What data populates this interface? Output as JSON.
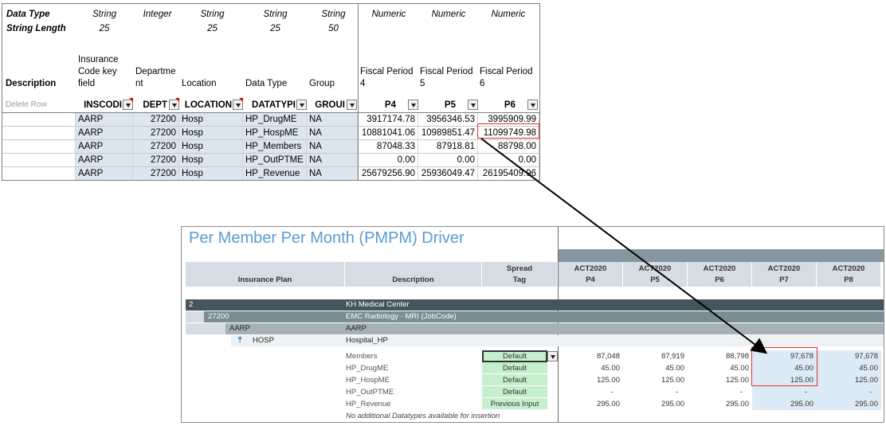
{
  "sheet": {
    "meta_labels": {
      "data_type": "Data Type",
      "string_length": "String Length"
    },
    "meta_types": [
      "String",
      "Integer",
      "String",
      "String",
      "String",
      "Numeric",
      "Numeric",
      "Numeric"
    ],
    "meta_lengths": [
      "25",
      "",
      "25",
      "25",
      "50"
    ],
    "headers": {
      "description": "Description",
      "insurance_code_1": "Insurance",
      "insurance_code_2": "Code key",
      "insurance_code_3": "field",
      "department_1": "Departme",
      "department_2": "nt",
      "location": "Location",
      "data_type": "Data Type",
      "group": "Group",
      "fp4_1": "Fiscal Period",
      "fp4_2": "4",
      "fp5_1": "Fiscal Period",
      "fp5_2": "5",
      "fp6_1": "Fiscal Period",
      "fp6_2": "6"
    },
    "delete_row": "Delete Row",
    "field_headers": [
      "INSCODI",
      "DEPT",
      "LOCATION",
      "DATATYPI",
      "GROUI",
      "P4",
      "P5",
      "P6"
    ],
    "rows": [
      [
        "AARP",
        "27200",
        "Hosp",
        "HP_DrugME",
        "NA",
        "3917174.78",
        "3956346.53",
        "3995909.99"
      ],
      [
        "AARP",
        "27200",
        "Hosp",
        "HP_HospME",
        "NA",
        "10881041.06",
        "10989851.47",
        "11099749.98"
      ],
      [
        "AARP",
        "27200",
        "Hosp",
        "HP_Members",
        "NA",
        "87048.33",
        "87918.81",
        "88798.00"
      ],
      [
        "AARP",
        "27200",
        "Hosp",
        "HP_OutPTME",
        "NA",
        "0.00",
        "0.00",
        "0.00"
      ],
      [
        "AARP",
        "27200",
        "Hosp",
        "HP_Revenue",
        "NA",
        "25679256.90",
        "25936049.47",
        "26195409.96"
      ]
    ]
  },
  "panel": {
    "title": "Per Member Per Month (PMPM) Driver",
    "col_headers": {
      "insurance_plan": "Insurance Plan",
      "description": "Description",
      "spread_1": "Spread",
      "spread_2": "Tag"
    },
    "period_headers": [
      {
        "top": "ACT2020",
        "bottom": "P4"
      },
      {
        "top": "ACT2020",
        "bottom": "P5"
      },
      {
        "top": "ACT2020",
        "bottom": "P6"
      },
      {
        "top": "ACT2020",
        "bottom": "P7"
      },
      {
        "top": "ACT2020",
        "bottom": "P8"
      }
    ],
    "tree": [
      {
        "code": "2",
        "desc": "KH Medical Center"
      },
      {
        "code": "27200",
        "desc": "EMC Radiology - MRI (JobCode)"
      },
      {
        "code": "AARP",
        "desc": "AARP"
      },
      {
        "code": "HOSP",
        "desc": "Hospital_HP"
      }
    ],
    "rows": [
      {
        "desc": "Members",
        "tag": "Default",
        "values": [
          "87,048",
          "87,919",
          "88,798",
          "97,678",
          "97,678"
        ]
      },
      {
        "desc": "HP_DrugME",
        "tag": "Default",
        "values": [
          "45.00",
          "45.00",
          "45.00",
          "45.00",
          "45.00"
        ]
      },
      {
        "desc": "HP_HospME",
        "tag": "Default",
        "values": [
          "125.00",
          "125.00",
          "125.00",
          "125.00",
          "125.00"
        ]
      },
      {
        "desc": "HP_OutPTME",
        "tag": "Default",
        "values": [
          "-",
          "-",
          "-",
          "-",
          "-"
        ]
      },
      {
        "desc": "HP_Revenue",
        "tag": "Previous Input",
        "values": [
          "295.00",
          "295.00",
          "295.00",
          "295.00",
          "295.00"
        ]
      }
    ],
    "footer_note": "No additional Datatypes available for insertion"
  },
  "colors": {
    "title_blue": "#5b9bd5",
    "highlight_red": "#e03030",
    "tag_green": "#c6efce",
    "header_gray": "#d6dce4"
  },
  "icons": {
    "dropdown": "chevron-down-icon",
    "pin": "pin-icon",
    "arrow": "arrow-connector"
  }
}
